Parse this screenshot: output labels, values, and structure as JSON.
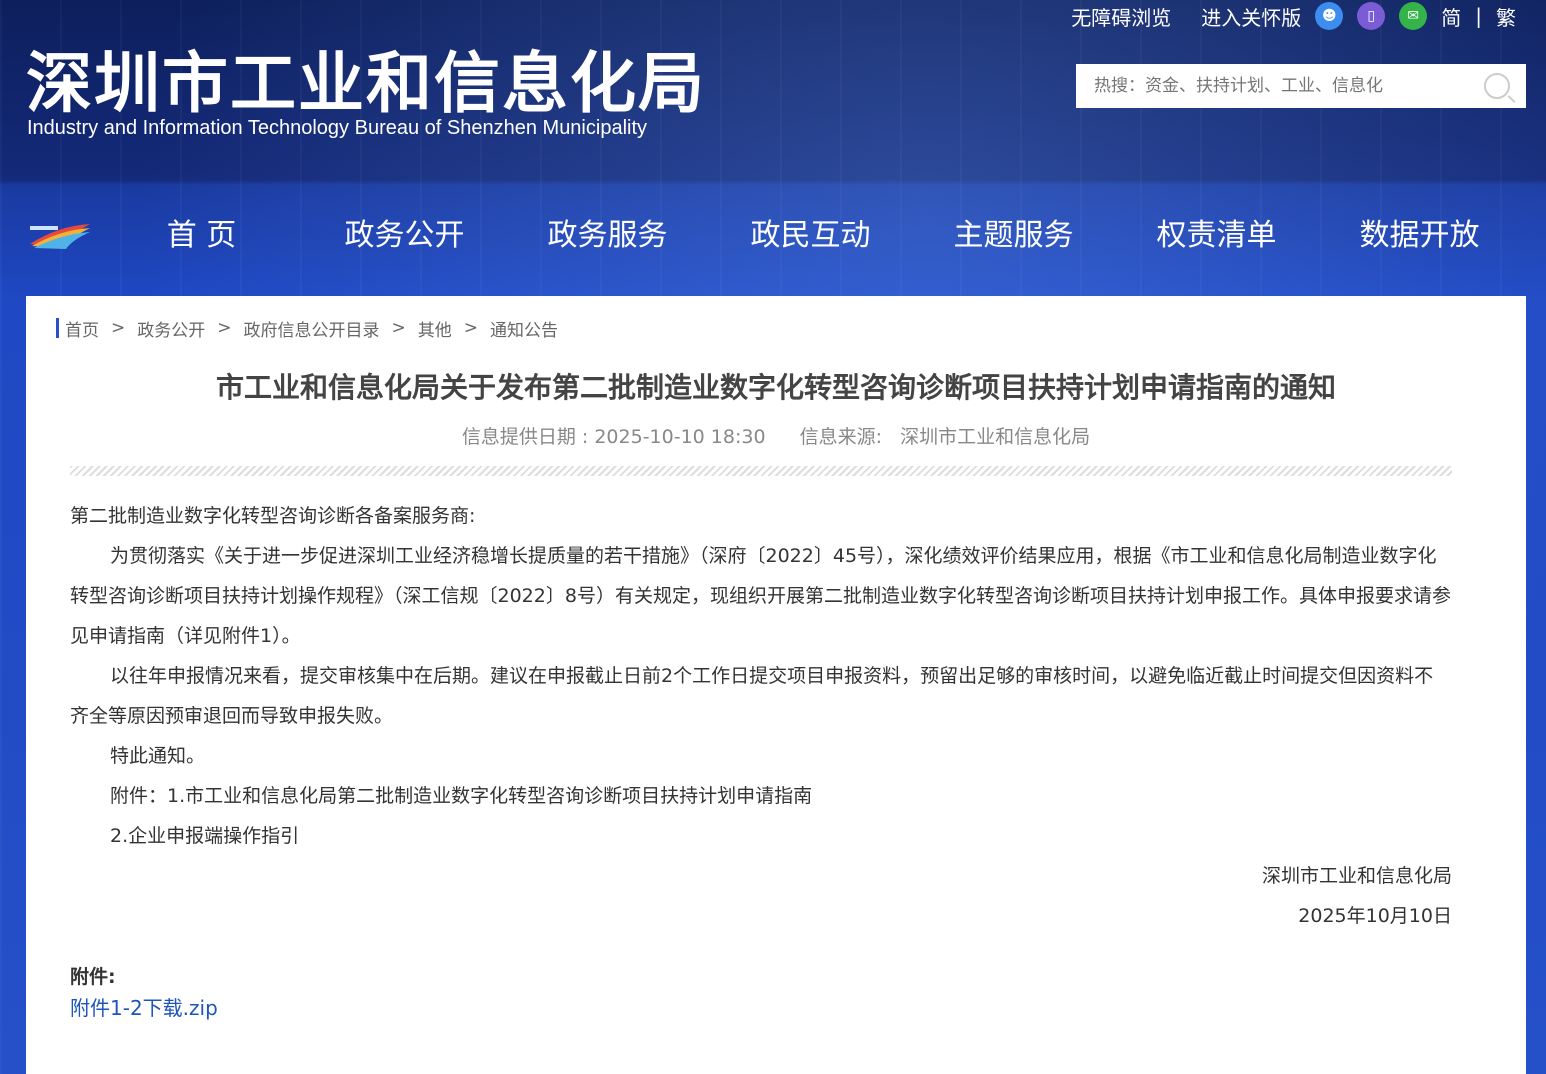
{
  "header": {
    "title_cn": "深圳市工业和信息化局",
    "title_en": "Industry and Information Technology Bureau of Shenzhen Municipality",
    "links": {
      "accessible": "无障碍浏览",
      "care": "进入关怀版",
      "simplified": "简",
      "separator": "|",
      "traditional": "繁"
    },
    "search": {
      "placeholder": "热搜：资金、扶持计划、工业、信息化"
    }
  },
  "nav": {
    "items": [
      "首 页",
      "政务公开",
      "政务服务",
      "政民互动",
      "主题服务",
      "权责清单",
      "数据开放"
    ]
  },
  "breadcrumb": {
    "items": [
      "首页",
      "政务公开",
      "政府信息公开目录",
      "其他",
      "通知公告"
    ],
    "arrow": ">"
  },
  "article": {
    "title": "市工业和信息化局关于发布第二批制造业数字化转型咨询诊断项目扶持计划申请指南的通知",
    "date_label": "信息提供日期 : 2025-10-10 18:30",
    "source_label": "信息来源:   深圳市工业和信息化局",
    "salutation": "第二批制造业数字化转型咨询诊断各备案服务商:",
    "para1": "为贯彻落实《关于进一步促进深圳工业经济稳增长提质量的若干措施》（深府〔2022〕45号），深化绩效评价结果应用，根据《市工业和信息化局制造业数字化转型咨询诊断项目扶持计划操作规程》（深工信规〔2022〕8号）有关规定，现组织开展第二批制造业数字化转型咨询诊断项目扶持计划申报工作。具体申报要求请参见申请指南（详见附件1）。",
    "para2": "以往年申报情况来看，提交审核集中在后期。建议在申报截止日前2个工作日提交项目申报资料，预留出足够的审核时间，以避免临近截止时间提交但因资料不齐全等原因预审退回而导致申报失败。",
    "para3": "特此通知。",
    "attach1": "附件：1.市工业和信息化局第二批制造业数字化转型咨询诊断项目扶持计划申请指南",
    "attach2": "2.企业申报端操作指引",
    "signature": "深圳市工业和信息化局",
    "sign_date": "2025年10月10日",
    "attachments_label": "附件:",
    "attachment_link": "附件1-2下载.zip"
  }
}
